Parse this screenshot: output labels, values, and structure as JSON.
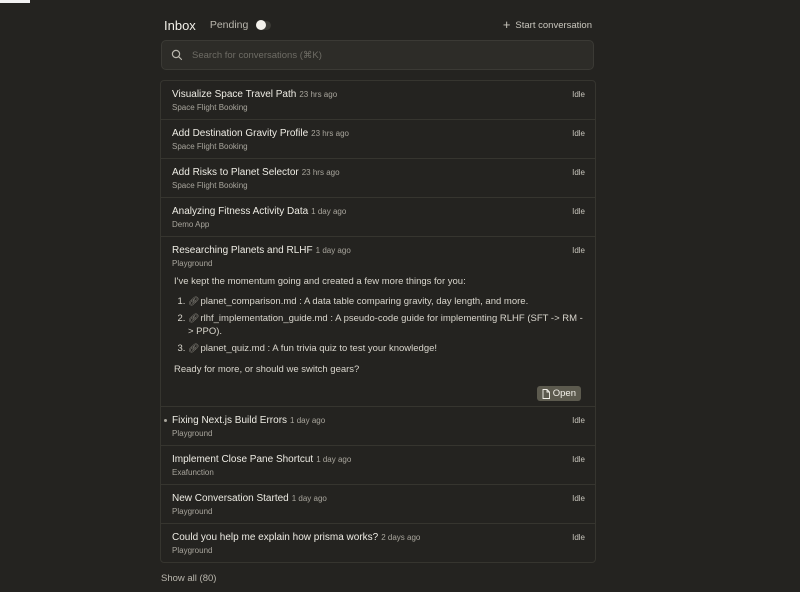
{
  "header": {
    "title": "Inbox",
    "pending_label": "Pending",
    "start_conversation": "Start conversation"
  },
  "search": {
    "placeholder": "Search for conversations (⌘K)"
  },
  "conversations": [
    {
      "title": "Visualize Space Travel Path",
      "time": "23 hrs ago",
      "project": "Space Flight Booking",
      "status": "Idle"
    },
    {
      "title": "Add Destination Gravity Profile",
      "time": "23 hrs ago",
      "project": "Space Flight Booking",
      "status": "Idle"
    },
    {
      "title": "Add Risks to Planet Selector",
      "time": "23 hrs ago",
      "project": "Space Flight Booking",
      "status": "Idle"
    },
    {
      "title": "Analyzing Fitness Activity Data",
      "time": "1 day ago",
      "project": "Demo App",
      "status": "Idle"
    },
    {
      "title": "Researching Planets and RLHF",
      "time": "1 day ago",
      "project": "Playground",
      "status": "Idle",
      "expanded": {
        "intro": "I've kept the momentum going and created a few more things for you:",
        "files": [
          {
            "name": "planet_comparison.md",
            "desc": ": A data table comparing gravity, day length, and more."
          },
          {
            "name": "rlhf_implementation_guide.md",
            "desc": ": A pseudo-code guide for implementing RLHF (SFT -> RM -> PPO)."
          },
          {
            "name": "planet_quiz.md",
            "desc": ": A fun trivia quiz to test your knowledge!"
          }
        ],
        "outro": "Ready for more, or should we switch gears?",
        "open_label": "Open"
      }
    },
    {
      "title": "Fixing Next.js Build Errors",
      "time": "1 day ago",
      "project": "Playground",
      "status": "Idle"
    },
    {
      "title": "Implement Close Pane Shortcut",
      "time": "1 day ago",
      "project": "Exafunction",
      "status": "Idle"
    },
    {
      "title": "New Conversation Started",
      "time": "1 day ago",
      "project": "Playground",
      "status": "Idle"
    },
    {
      "title": "Could you help me explain how prisma works?",
      "time": "2 days ago",
      "project": "Playground",
      "status": "Idle"
    }
  ],
  "footer": {
    "show_all": "Show all (80)"
  }
}
